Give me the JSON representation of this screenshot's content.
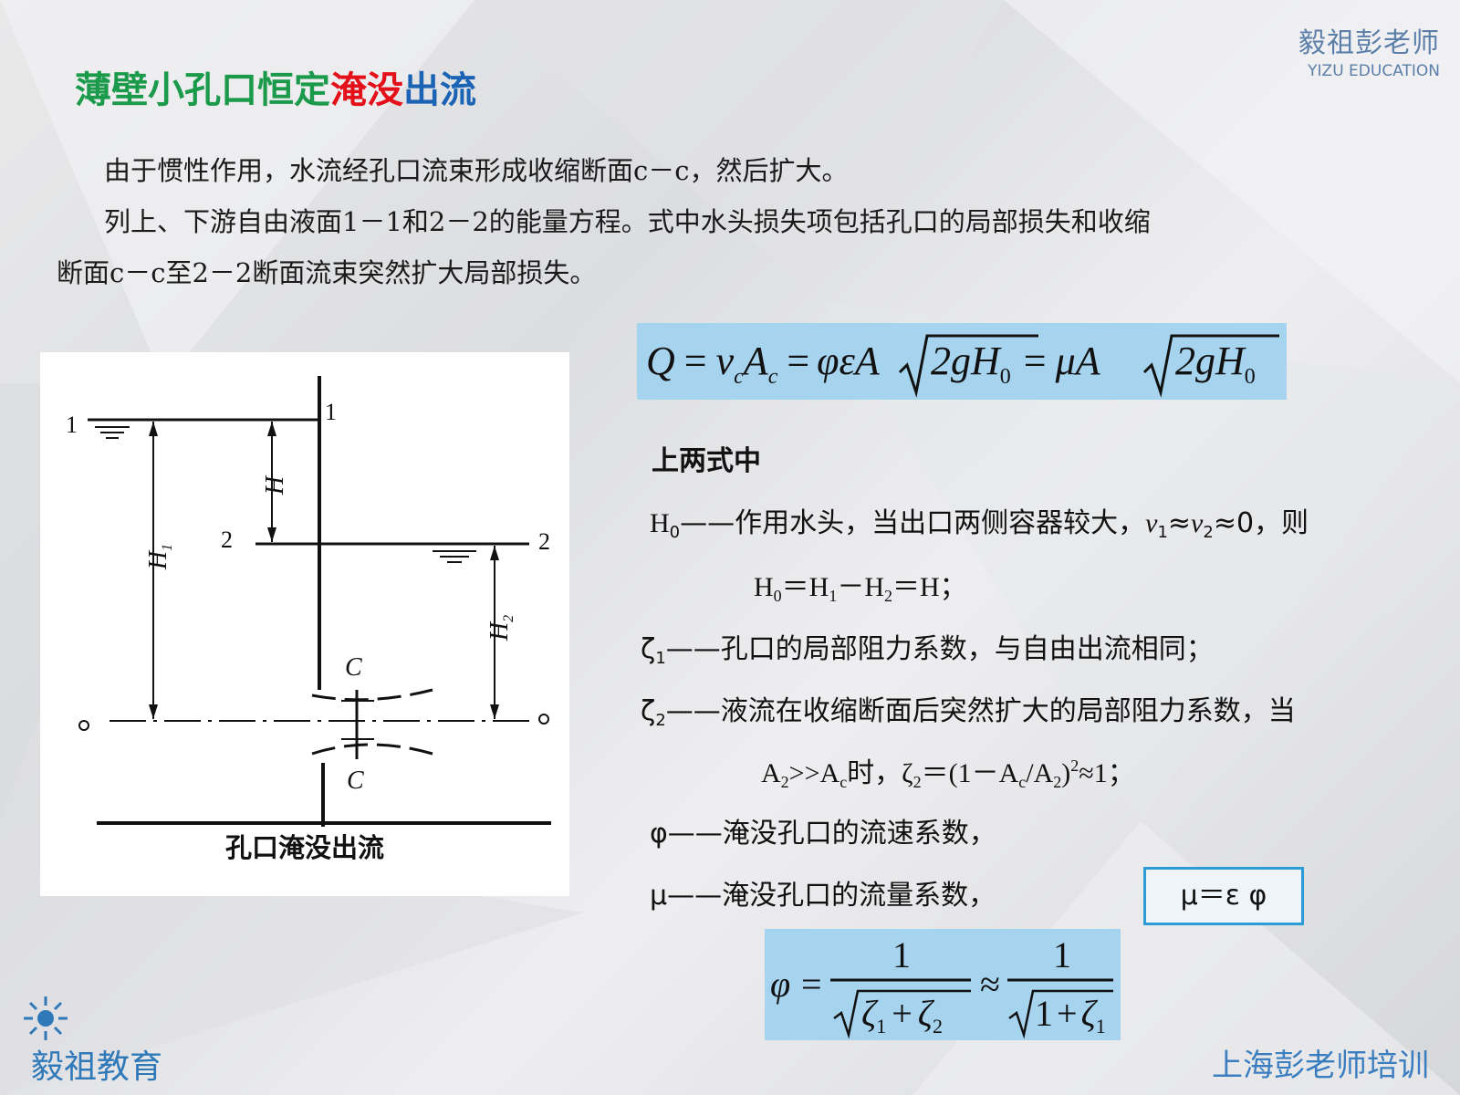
{
  "brand": {
    "cn": "毅祖彭老师",
    "en": "YIZU EDUCATION"
  },
  "title": {
    "part1": "薄壁小孔口恒定",
    "part2": "淹没",
    "part3": "出流"
  },
  "paragraphs": {
    "p1": "由于惯性作用，水流经孔口流束形成收缩断面c－c，然后扩大。",
    "p2a": "列上、下游自由液面1－1和2－2的能量方程。式中水头损失项包括孔口的局部损失和收缩",
    "p2b": "断面c－c至2－2断面流束突然扩大局部损失。"
  },
  "figure": {
    "caption": "孔口淹没出流",
    "labels": {
      "l1_left": "1",
      "l1_right": "1",
      "l2_left": "2",
      "l2_right": "2",
      "H": "H",
      "H1": "H",
      "H1_sub": "1",
      "H2": "H",
      "H2_sub": "2",
      "C_top": "C",
      "C_bottom": "C",
      "o_left": "o",
      "o_right": "o"
    }
  },
  "formula_main": {
    "Q": "Q",
    "eq": "=",
    "v": "v",
    "c": "c",
    "A": "A",
    "phi": "φ",
    "eps": "ε",
    "two_g_H": "2gH",
    "zero": "0",
    "mu": "μ"
  },
  "defs": {
    "header": "上两式中",
    "h0_sym": "H",
    "h0_sub": "0",
    "h0_text": "——作用水头，当出口两侧容器较大，",
    "v1": "v",
    "v1_sub": "1",
    "approx1": "≈",
    "v2": "v",
    "v2_sub": "2",
    "approx2": "≈0，则",
    "h0_eq_a": "H",
    "h0_eq_a_sub": "0",
    "h0_eq_b": "＝H",
    "h0_eq_b_sub": "1",
    "h0_eq_c": "－H",
    "h0_eq_c_sub": "2",
    "h0_eq_d": "＝H；",
    "z1_sym": "ζ",
    "z1_sub": "1",
    "z1_text": "——孔口的局部阻力系数，与自由出流相同；",
    "z2_sym": "ζ",
    "z2_sub": "2",
    "z2_text": "——液流在收缩断面后突然扩大的局部阻力系数，当",
    "a_line_a": "A",
    "a_line_a_sub": "2",
    "a_line_b": ">>A",
    "a_line_b_sub": "c",
    "a_line_c": "时，ζ",
    "a_line_c_sub": "2",
    "a_line_d": "＝(1－A",
    "a_line_d_sub": "c",
    "a_line_e": "/A",
    "a_line_e_sub": "2",
    "a_line_f": ")",
    "a_line_f_sup": "2",
    "a_line_g": "≈1；",
    "phi_text": "φ——淹没孔口的流速系数，",
    "mu_text": "μ——淹没孔口的流量系数，"
  },
  "mu_box": "μ＝ε φ",
  "formula_phi": {
    "phi": "φ",
    "eq": "=",
    "one": "1",
    "approx": "≈",
    "zeta": "ζ",
    "sub1": "1",
    "sub2": "2",
    "plus": "+",
    "one_b": "1"
  },
  "footer": {
    "logo": "毅祖教育",
    "right": "上海彭老师培训"
  },
  "colors": {
    "title_green": "#1a9a4a",
    "title_blue": "#1b63b5",
    "title_red": "#e4101a",
    "formula_bg": "#a6d3ee",
    "mu_border": "#2c9bd6",
    "brand_blue": "#3a7ec0"
  }
}
